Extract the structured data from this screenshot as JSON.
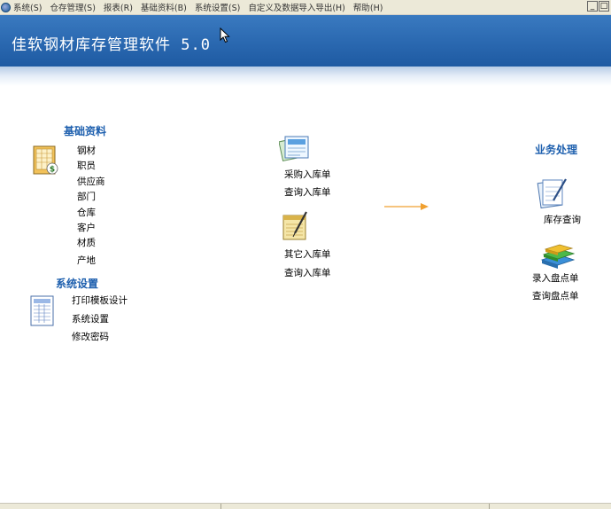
{
  "menu": {
    "items": [
      "系统(S)",
      "仓存管理(S)",
      "报表(R)",
      "基础资料(B)",
      "系统设置(S)",
      "自定义及数据导入导出(H)",
      "帮助(H)"
    ],
    "window_buttons": [
      "_",
      "□"
    ]
  },
  "header": {
    "title": "佳软钢材库存管理软件 5.0",
    "color_top": "#3a7ac0",
    "color_bottom": "#1e5aa2"
  },
  "basic_data": {
    "heading": "基础资料",
    "items": [
      "钢材",
      "职员",
      "供应商",
      "部门",
      "仓库",
      "客户",
      "材质",
      "产地"
    ]
  },
  "system_settings": {
    "heading": "系统设置",
    "items": [
      "打印模板设计",
      "系统设置",
      "修改密码"
    ]
  },
  "purchase": {
    "items": [
      "采购入库单",
      "查询入库单"
    ]
  },
  "other_in": {
    "items": [
      "其它入库单",
      "查询入库单"
    ]
  },
  "business": {
    "heading": "业务处理",
    "stock_query": "库存查询",
    "inventory_items": [
      "录入盘点单",
      "查询盘点单"
    ]
  },
  "icons": {
    "basic_data": "spreadsheet-dollar-icon",
    "system_settings": "print-document-icon",
    "purchase": "purchase-documents-icon",
    "other_in": "notepad-pen-icon",
    "stock_query": "clipboard-pen-icon",
    "inventory": "stacked-books-icon",
    "flow_arrow": "orange-arrow-icon"
  },
  "colors": {
    "heading": "#1d5fae",
    "arrow": "#f0a030",
    "menubar": "#ece9d8"
  }
}
